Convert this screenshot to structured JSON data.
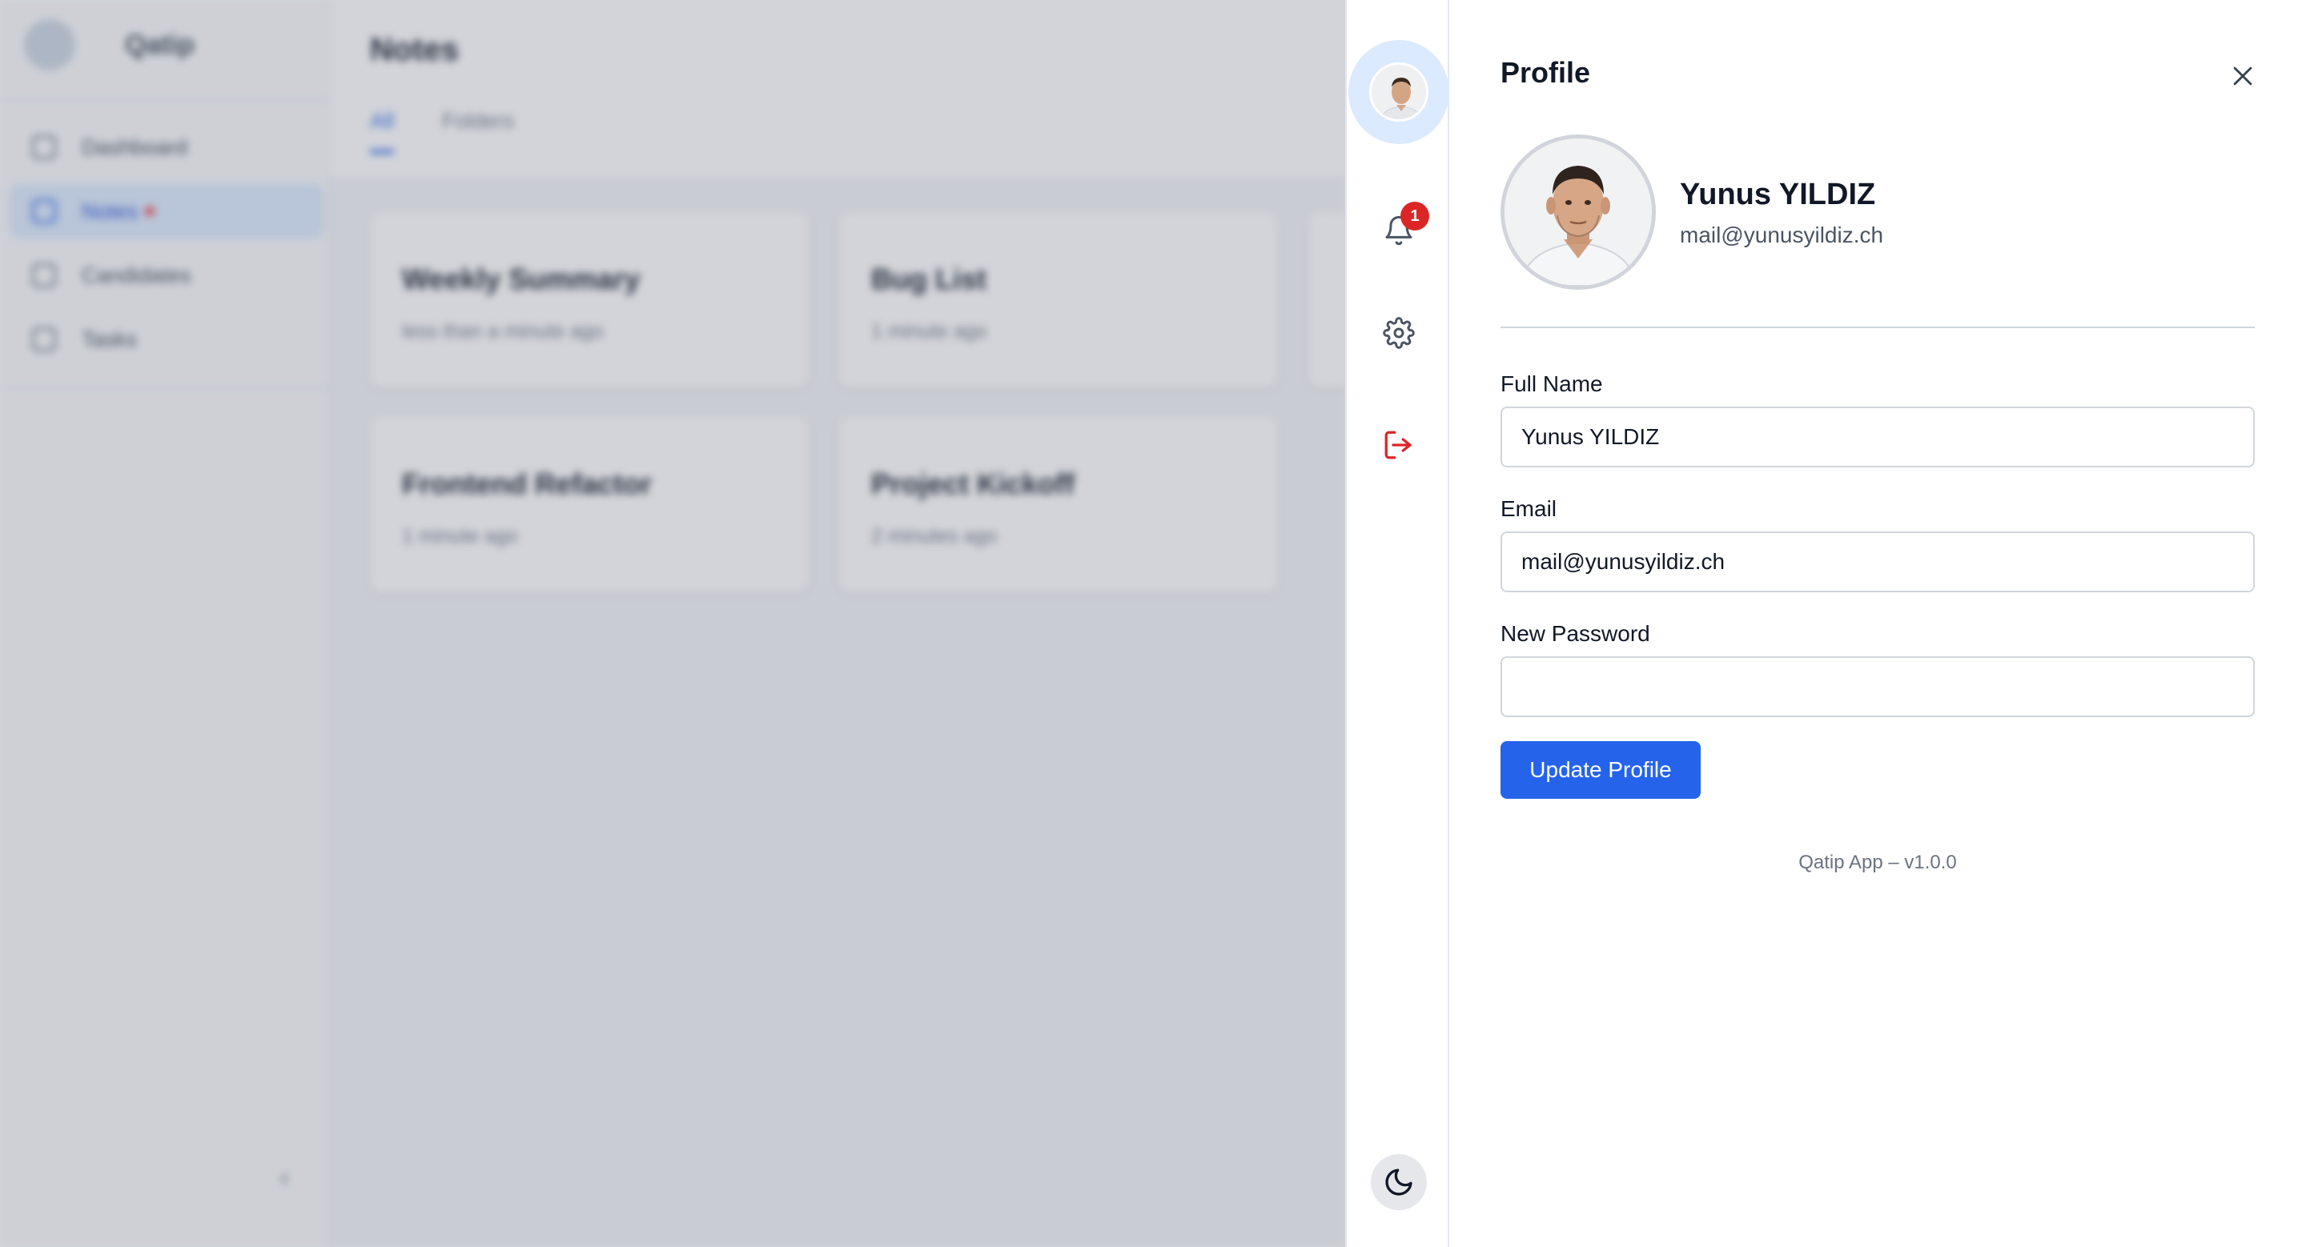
{
  "background_app": {
    "brand": "Qatip",
    "sidebar": {
      "items": [
        {
          "label": "Dashboard",
          "icon": "dashboard-icon"
        },
        {
          "label": "Notes",
          "icon": "notes-icon",
          "active": true,
          "has_dot": true
        },
        {
          "label": "Candidates",
          "icon": "candidates-icon"
        },
        {
          "label": "Tasks",
          "icon": "tasks-icon"
        }
      ],
      "collapse_glyph": "‹"
    },
    "page_title": "Notes",
    "tabs": [
      {
        "label": "All",
        "active": true
      },
      {
        "label": "Folders",
        "active": false
      }
    ],
    "cards": [
      {
        "title": "Weekly Summary",
        "time": "less than a minute ago"
      },
      {
        "title": "Bug List",
        "time": "1 minute ago"
      },
      {
        "title": "Frontend Refactor",
        "time": "1 minute ago"
      },
      {
        "title": "Project Kickoff",
        "time": "2 minutes ago"
      }
    ]
  },
  "rail": {
    "notifications_count": "1",
    "icons": [
      "avatar",
      "bell-icon",
      "gear-icon",
      "logout-icon",
      "moon-icon"
    ]
  },
  "panel": {
    "title": "Profile",
    "user": {
      "name": "Yunus YILDIZ",
      "email": "mail@yunusyildiz.ch"
    },
    "form": {
      "full_name_label": "Full Name",
      "full_name_value": "Yunus YILDIZ",
      "email_label": "Email",
      "email_value": "mail@yunusyildiz.ch",
      "password_label": "New Password",
      "password_value": "",
      "submit_label": "Update Profile"
    },
    "footer": "Qatip App – v1.0.0"
  },
  "colors": {
    "accent": "#2563eb",
    "badge": "#dc2626",
    "logout": "#dc2626",
    "avatar_ring": "#dbeafe"
  }
}
